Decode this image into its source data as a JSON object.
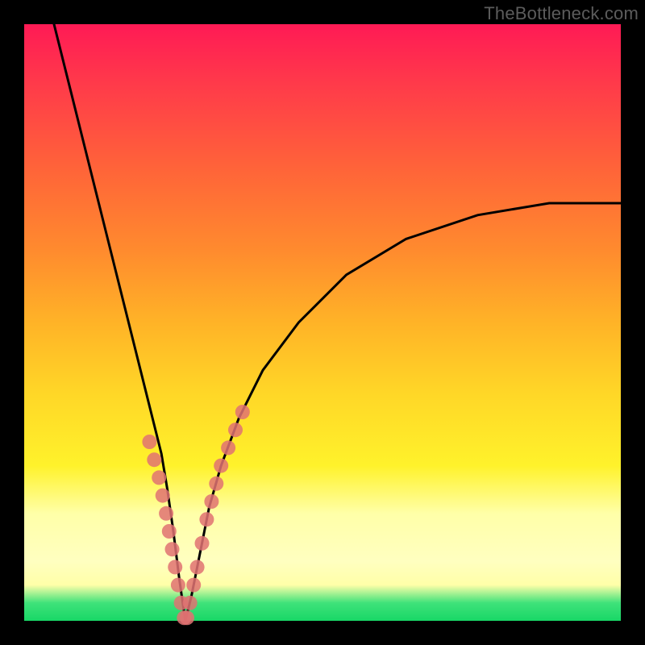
{
  "watermark": "TheBottleneck.com",
  "colors": {
    "frame": "#000000",
    "curve": "#000000",
    "marker": "#e07272",
    "gradient_top": "#ff1a55",
    "gradient_bottom": "#18d766"
  },
  "chart_data": {
    "type": "line",
    "title": "",
    "xlabel": "",
    "ylabel": "",
    "xlim": [
      0,
      100
    ],
    "ylim": [
      0,
      100
    ],
    "note": "V-shaped bottleneck curve. x is a normalized component-balance axis, y is bottleneck percentage. Vertex at roughly x=27, y=0. Left branch starts near (5,100); right branch ends near (100,70). No numeric axis ticks are shown in the image; values are read off the plot-area proportions.",
    "series": [
      {
        "name": "bottleneck-curve",
        "x": [
          5,
          8,
          12,
          16,
          19,
          21,
          23,
          24,
          25,
          26,
          27,
          28,
          29,
          30,
          31,
          33,
          36,
          40,
          46,
          54,
          64,
          76,
          88,
          100
        ],
        "y": [
          100,
          88,
          72,
          56,
          44,
          36,
          28,
          22,
          15,
          7,
          0,
          4,
          9,
          14,
          19,
          26,
          34,
          42,
          50,
          58,
          64,
          68,
          70,
          70
        ]
      }
    ],
    "markers": {
      "name": "highlighted-points",
      "note": "Salmon dots clustered near the vertex on both branches, roughly in the y=0–30 band.",
      "x": [
        21.0,
        21.8,
        22.6,
        23.2,
        23.8,
        24.3,
        24.8,
        25.3,
        25.8,
        26.3,
        26.8,
        27.3,
        27.8,
        28.4,
        29.0,
        29.8,
        30.6,
        31.4,
        32.2,
        33.0,
        34.2,
        35.4,
        36.6
      ],
      "y": [
        30,
        27,
        24,
        21,
        18,
        15,
        12,
        9,
        6,
        3,
        0.5,
        0.5,
        3,
        6,
        9,
        13,
        17,
        20,
        23,
        26,
        29,
        32,
        35
      ]
    }
  }
}
